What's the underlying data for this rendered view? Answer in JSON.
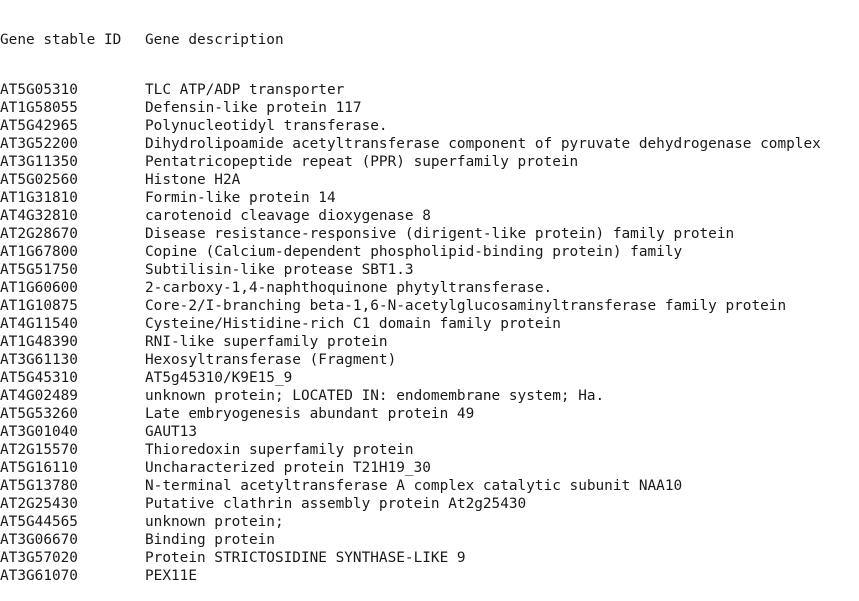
{
  "table": {
    "headers": {
      "gene_stable_id": "Gene stable ID",
      "gene_description": "Gene description"
    },
    "rows": [
      {
        "id": "AT5G05310",
        "desc": "TLC ATP/ADP transporter"
      },
      {
        "id": "AT1G58055",
        "desc": "Defensin-like protein 117"
      },
      {
        "id": "AT5G42965",
        "desc": "Polynucleotidyl transferase."
      },
      {
        "id": "AT3G52200",
        "desc": "Dihydrolipoamide acetyltransferase component of pyruvate dehydrogenase complex"
      },
      {
        "id": "AT3G11350",
        "desc": "Pentatricopeptide repeat (PPR) superfamily protein"
      },
      {
        "id": "AT5G02560",
        "desc": "Histone H2A"
      },
      {
        "id": "AT1G31810",
        "desc": "Formin-like protein 14"
      },
      {
        "id": "AT4G32810",
        "desc": "carotenoid cleavage dioxygenase 8"
      },
      {
        "id": "AT2G28670",
        "desc": "Disease resistance-responsive (dirigent-like protein) family protein"
      },
      {
        "id": "AT1G67800",
        "desc": "Copine (Calcium-dependent phospholipid-binding protein) family"
      },
      {
        "id": "AT5G51750",
        "desc": "Subtilisin-like protease SBT1.3"
      },
      {
        "id": "AT1G60600",
        "desc": "2-carboxy-1,4-naphthoquinone phytyltransferase."
      },
      {
        "id": "AT1G10875",
        "desc": "Core-2/I-branching beta-1,6-N-acetylglucosaminyltransferase family protein"
      },
      {
        "id": "AT4G11540",
        "desc": "Cysteine/Histidine-rich C1 domain family protein"
      },
      {
        "id": "AT1G48390",
        "desc": "RNI-like superfamily protein"
      },
      {
        "id": "AT3G61130",
        "desc": "Hexosyltransferase (Fragment)"
      },
      {
        "id": "AT5G45310",
        "desc": "AT5g45310/K9E15_9"
      },
      {
        "id": "AT4G02489",
        "desc": "unknown protein; LOCATED IN: endomembrane system; Ha."
      },
      {
        "id": "AT5G53260",
        "desc": "Late embryogenesis abundant protein 49"
      },
      {
        "id": "AT3G01040",
        "desc": "GAUT13"
      },
      {
        "id": "AT2G15570",
        "desc": "Thioredoxin superfamily protein"
      },
      {
        "id": "AT5G16110",
        "desc": "Uncharacterized protein T21H19_30"
      },
      {
        "id": "AT5G13780",
        "desc": "N-terminal acetyltransferase A complex catalytic subunit NAA10"
      },
      {
        "id": "AT2G25430",
        "desc": "Putative clathrin assembly protein At2g25430"
      },
      {
        "id": "AT5G44565",
        "desc": "unknown protein;"
      },
      {
        "id": "AT3G06670",
        "desc": "Binding protein"
      },
      {
        "id": "AT3G57020",
        "desc": "Protein STRICTOSIDINE SYNTHASE-LIKE 9"
      },
      {
        "id": "AT3G61070",
        "desc": "PEX11E"
      }
    ]
  }
}
